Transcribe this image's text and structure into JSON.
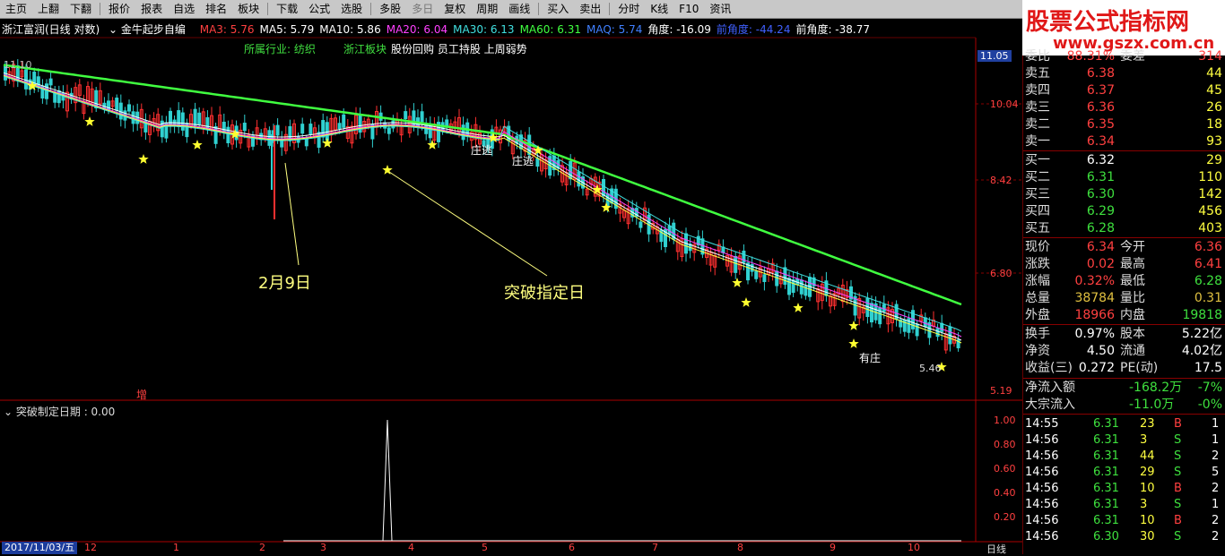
{
  "toolbar": {
    "items": [
      "主页",
      "上翻",
      "下翻",
      "报价",
      "报表",
      "自选",
      "排名",
      "板块",
      "下载",
      "公式",
      "选股",
      "多股",
      "多日",
      "复权",
      "周期",
      "画线",
      "买入",
      "卖出",
      "分时",
      "K线",
      "F10",
      "资讯"
    ]
  },
  "watermark": {
    "title": "股票公式指标网",
    "url": "www.gszx.com.cn"
  },
  "chart": {
    "stock_title": "浙江富润(日线 对数)",
    "formula": "金牛起步自编",
    "ma": [
      {
        "label": "MA3: 5.76",
        "color": "#ff4040"
      },
      {
        "label": "MA5: 5.79",
        "color": "#ffffff"
      },
      {
        "label": "MA10: 5.86",
        "color": "#ffffff"
      },
      {
        "label": "MA20: 6.04",
        "color": "#ff40ff"
      },
      {
        "label": "MA30: 6.13",
        "color": "#40e0e0"
      },
      {
        "label": "MA60: 6.31",
        "color": "#40ff40"
      },
      {
        "label": "MAQ: 5.74",
        "color": "#4080ff"
      },
      {
        "label": "角度: -16.09",
        "color": "#ffffff"
      },
      {
        "label": "前角度: -44.24",
        "color": "#4060ff"
      },
      {
        "label": "前角度: -38.77",
        "color": "#ffffff"
      }
    ],
    "industry_label": "所属行业: 纺织",
    "block_label": "浙江板块",
    "concepts": "股份回购 员工持股 上周弱势",
    "price_ticks": [
      "11.05",
      "10.04",
      "8.42",
      "6.80",
      "5.19"
    ],
    "high_label": "11.10",
    "low_label": "5.46",
    "annotations": {
      "feb9": "2月9日",
      "breakout": "突破指定日",
      "zhuang1": "庄逃",
      "zhuang2": "庄逃",
      "youzhuang": "有庄",
      "zeng": "增"
    },
    "indicator_title": "突破制定日期 : 0.00",
    "indicator_ticks": [
      "1.00",
      "0.80",
      "0.60",
      "0.40",
      "0.20"
    ],
    "date_tag": "2017/11/03/五",
    "month_labels": [
      "12",
      "1",
      "2",
      "3",
      "4",
      "5",
      "6",
      "7",
      "8",
      "9",
      "10"
    ],
    "period_label": "日线"
  },
  "quote": {
    "top": {
      "l1": "委比",
      "v1": "88.31%",
      "l2": "委差",
      "v2": "314"
    },
    "asks": [
      {
        "label": "卖五",
        "price": "6.38",
        "vol": "44"
      },
      {
        "label": "卖四",
        "price": "6.37",
        "vol": "45"
      },
      {
        "label": "卖三",
        "price": "6.36",
        "vol": "26"
      },
      {
        "label": "卖二",
        "price": "6.35",
        "vol": "18"
      },
      {
        "label": "卖一",
        "price": "6.34",
        "vol": "93"
      }
    ],
    "bids": [
      {
        "label": "买一",
        "price": "6.32",
        "vol": "29"
      },
      {
        "label": "买二",
        "price": "6.31",
        "vol": "110"
      },
      {
        "label": "买三",
        "price": "6.30",
        "vol": "142"
      },
      {
        "label": "买四",
        "price": "6.29",
        "vol": "456"
      },
      {
        "label": "买五",
        "price": "6.28",
        "vol": "403"
      }
    ],
    "stats": [
      {
        "l1": "现价",
        "v1": "6.34",
        "c1": "red",
        "l2": "今开",
        "v2": "6.36",
        "c2": "red"
      },
      {
        "l1": "涨跌",
        "v1": "0.02",
        "c1": "red",
        "l2": "最高",
        "v2": "6.41",
        "c2": "red"
      },
      {
        "l1": "涨幅",
        "v1": "0.32%",
        "c1": "red",
        "l2": "最低",
        "v2": "6.28",
        "c2": "green"
      },
      {
        "l1": "总量",
        "v1": "38784",
        "c1": "amber",
        "l2": "量比",
        "v2": "0.31",
        "c2": "amber"
      },
      {
        "l1": "外盘",
        "v1": "18966",
        "c1": "red",
        "l2": "内盘",
        "v2": "19818",
        "c2": "green"
      }
    ],
    "fund": [
      {
        "l1": "换手",
        "v1": "0.97%",
        "l2": "股本",
        "v2": "5.22亿"
      },
      {
        "l1": "净资",
        "v1": "4.50",
        "l2": "流通",
        "v2": "4.02亿"
      },
      {
        "l1": "收益(三)",
        "v1": "0.272",
        "l2": "PE(动)",
        "v2": "17.5"
      }
    ],
    "flow": [
      {
        "label": "净流入额",
        "value": "-168.2万",
        "pct": "-7%"
      },
      {
        "label": "大宗流入",
        "value": "-11.0万",
        "pct": "-0%"
      }
    ],
    "ticks": [
      {
        "t": "14:55",
        "p": "6.31",
        "v": "23",
        "s": "B",
        "n": "1"
      },
      {
        "t": "14:56",
        "p": "6.31",
        "v": "3",
        "s": "S",
        "n": "1"
      },
      {
        "t": "14:56",
        "p": "6.31",
        "v": "44",
        "s": "S",
        "n": "2"
      },
      {
        "t": "14:56",
        "p": "6.31",
        "v": "29",
        "s": "S",
        "n": "5"
      },
      {
        "t": "14:56",
        "p": "6.31",
        "v": "10",
        "s": "B",
        "n": "2"
      },
      {
        "t": "14:56",
        "p": "6.31",
        "v": "3",
        "s": "S",
        "n": "1"
      },
      {
        "t": "14:56",
        "p": "6.31",
        "v": "10",
        "s": "B",
        "n": "2"
      },
      {
        "t": "14:56",
        "p": "6.30",
        "v": "30",
        "s": "S",
        "n": "2"
      }
    ]
  }
}
